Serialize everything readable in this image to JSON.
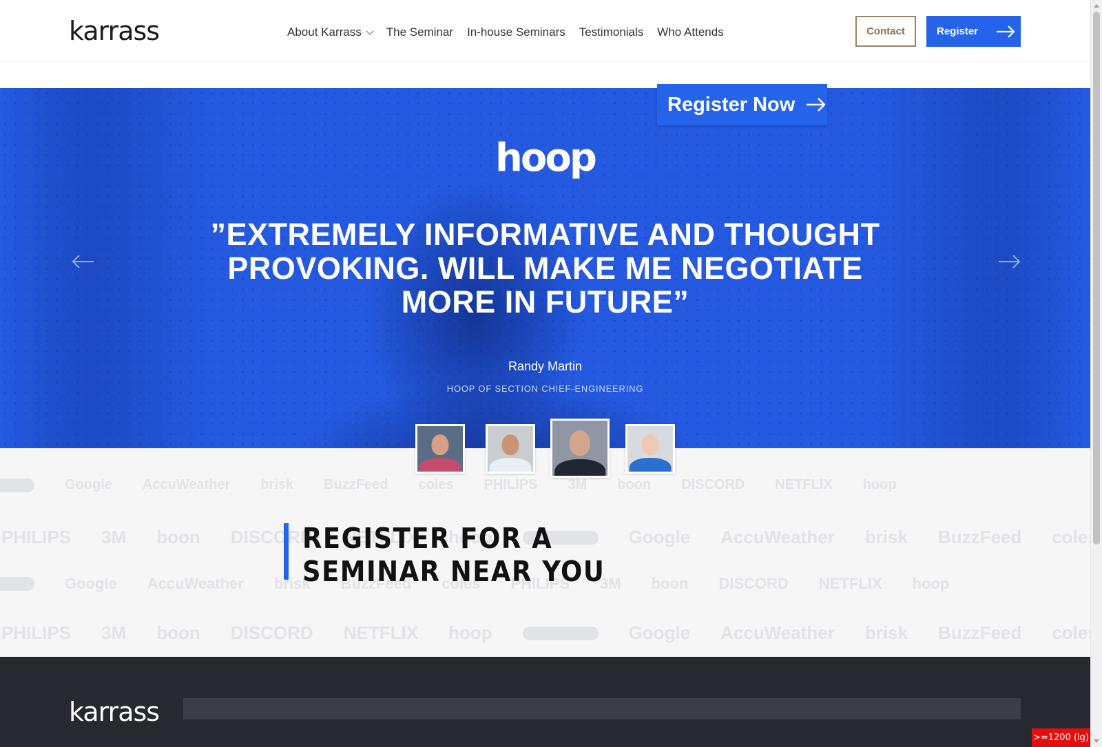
{
  "header": {
    "logo": "karrass",
    "nav": [
      {
        "label": "About Karrass",
        "has_dropdown": true
      },
      {
        "label": "The Seminar",
        "has_dropdown": false
      },
      {
        "label": "In-house Seminars",
        "has_dropdown": false
      },
      {
        "label": "Testimonials",
        "has_dropdown": false
      },
      {
        "label": "Who Attends",
        "has_dropdown": false
      }
    ],
    "contact_label": "Contact",
    "register_label": "Register",
    "register_icon": "arrow-right-icon"
  },
  "hero": {
    "company_logo": "hoop",
    "quote": "”EXTREMELY INFORMATIVE AND THOUGHT PROVOKING. WILL MAKE ME NEGOTIATE MORE IN FUTURE”",
    "author": "Randy Martin",
    "author_title": "HOOP OF SECTION CHIEF-ENGINEERING",
    "prev_icon": "arrow-left-icon",
    "next_icon": "arrow-right-icon",
    "background_color": "#2459e0",
    "thumbnails": [
      {
        "name": "testimonial-thumb-1",
        "active": false,
        "bg": "#5b6c86",
        "shirt": "#c24d6c",
        "skin": "#d5a085"
      },
      {
        "name": "testimonial-thumb-2",
        "active": false,
        "bg": "#c9cdd2",
        "shirt": "#e9eef5",
        "skin": "#c99476"
      },
      {
        "name": "testimonial-thumb-3",
        "active": true,
        "bg": "#8e97a3",
        "shirt": "#222632",
        "skin": "#d3a58a"
      },
      {
        "name": "testimonial-thumb-4",
        "active": false,
        "bg": "#d7dade",
        "shirt": "#2b6fd0",
        "skin": "#efc9b4"
      }
    ]
  },
  "register_band": {
    "title": "REGISTER FOR A SEMINAR NEAR YOU",
    "button_label": "Register Now",
    "button_icon": "arrow-right-icon",
    "brand_rows": [
      [
        "Google",
        "AccuWeather",
        "brisk",
        "BuzzFeed",
        "coles",
        "PHILIPS",
        "3M",
        "boon",
        "DISCORD",
        "NETFLIX",
        "hoop"
      ],
      [
        "PHILIPS",
        "3M",
        "boon",
        "DISCORD",
        "NETFLIX",
        "hoop",
        "Google",
        "AccuWeather",
        "brisk",
        "BuzzFeed",
        "coles"
      ],
      [
        "Google",
        "AccuWeather",
        "brisk",
        "BuzzFeed",
        "coles",
        "PHILIPS",
        "3M",
        "boon",
        "DISCORD",
        "NETFLIX",
        "hoop"
      ],
      [
        "PHILIPS",
        "3M",
        "boon",
        "DISCORD",
        "NETFLIX",
        "hoop",
        "Google",
        "AccuWeather",
        "brisk",
        "BuzzFeed",
        "coles"
      ]
    ]
  },
  "footer": {
    "logo": "karrass"
  },
  "breakpoint_badge": ">=1200 (lg)",
  "colors": {
    "accent": "#2563eb",
    "contact_border": "#9c8268",
    "footer_bg": "#272930"
  }
}
